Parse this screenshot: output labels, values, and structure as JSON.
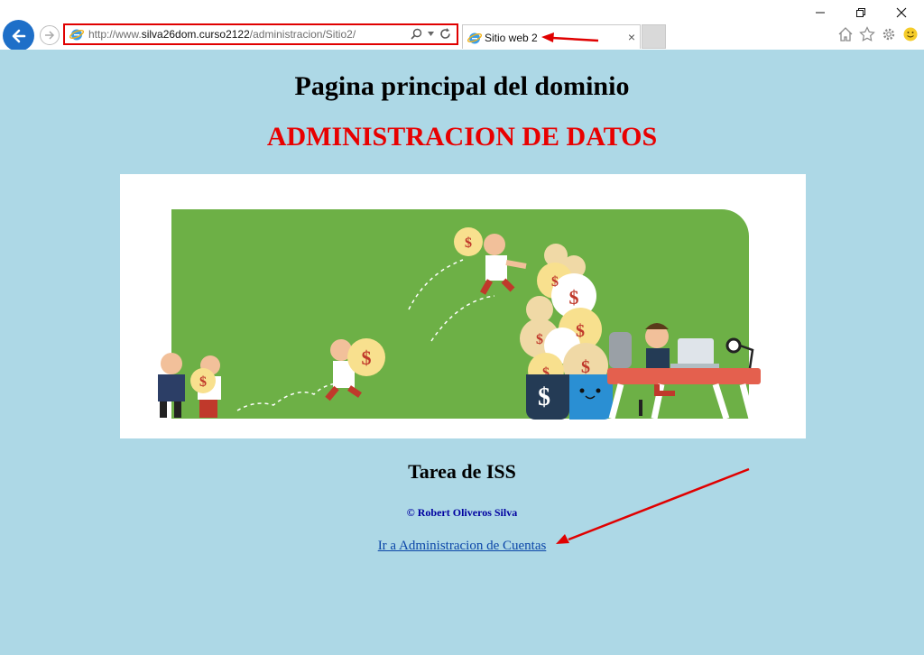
{
  "browser": {
    "url_prefix": "http://www.",
    "url_domain": "silva26dom.curso2122",
    "url_path": "/administracion/Sitio2/",
    "tab_title": "Sitio web 2",
    "tab_close": "×"
  },
  "page": {
    "heading": "Pagina principal del dominio",
    "subheading": "ADMINISTRACION DE DATOS",
    "task_title": "Tarea de ISS",
    "copyright": "© Robert Oliveros Silva",
    "link_label": "Ir a Administracion de Cuentas"
  },
  "colors": {
    "page_bg": "#add8e6",
    "subheading": "#e80000",
    "annotation_red": "#e00000",
    "banner_green": "#6db046"
  },
  "icons": [
    "back-arrow-icon",
    "forward-arrow-icon",
    "ie-logo-icon",
    "search-icon",
    "refresh-icon",
    "minimize-icon",
    "restore-icon",
    "close-icon",
    "home-icon",
    "favorites-star-icon",
    "settings-gear-icon",
    "smiley-icon"
  ]
}
